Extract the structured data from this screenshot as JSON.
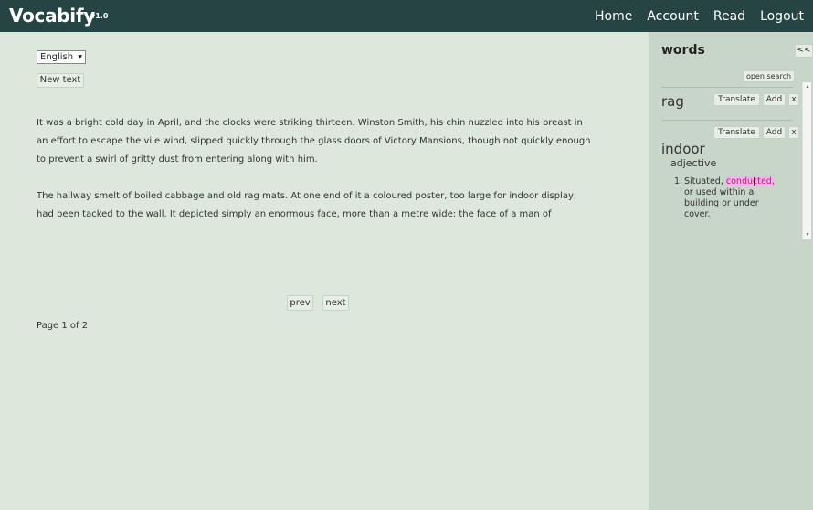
{
  "header": {
    "brand": "Vocabify",
    "version": "v1.0",
    "nav": [
      "Home",
      "Account",
      "Read",
      "Logout"
    ]
  },
  "main": {
    "language": "English",
    "new_text_label": "New text",
    "paragraphs": [
      "It was a bright cold day in April, and the clocks were striking thirteen. Winston Smith, his chin nuzzled into his breast in an effort to escape the vile wind, slipped quickly through the glass doors of Victory Mansions, though not quickly enough to prevent a swirl of gritty dust from entering along with him.",
      "The hallway smelt of boiled cabbage and old rag mats. At one end of it a coloured poster, too large for indoor display, had been tacked to the wall. It depicted simply an enormous face, more than a metre wide: the face of a man of"
    ],
    "prev_label": "prev",
    "next_label": "next",
    "page_info": "Page 1 of 2"
  },
  "sidebar": {
    "title": "words",
    "collapse_label": "<<",
    "open_search_label": "open search",
    "words": [
      {
        "word": "rag",
        "translate_label": "Translate",
        "add_label": "Add",
        "remove_label": "x"
      },
      {
        "word": "indoor",
        "translate_label": "Translate",
        "add_label": "Add",
        "remove_label": "x",
        "part_of_speech": "adjective",
        "definition_number": "1.",
        "definition_before": "Situated, ",
        "definition_highlight": "conducted,",
        "definition_after": " or used within a building or under cover."
      }
    ]
  },
  "colors": {
    "header_bg": "#264444",
    "page_bg": "#dde8dd",
    "sidebar_bg": "#c7d6c8",
    "highlight": "#f5b3e6"
  }
}
